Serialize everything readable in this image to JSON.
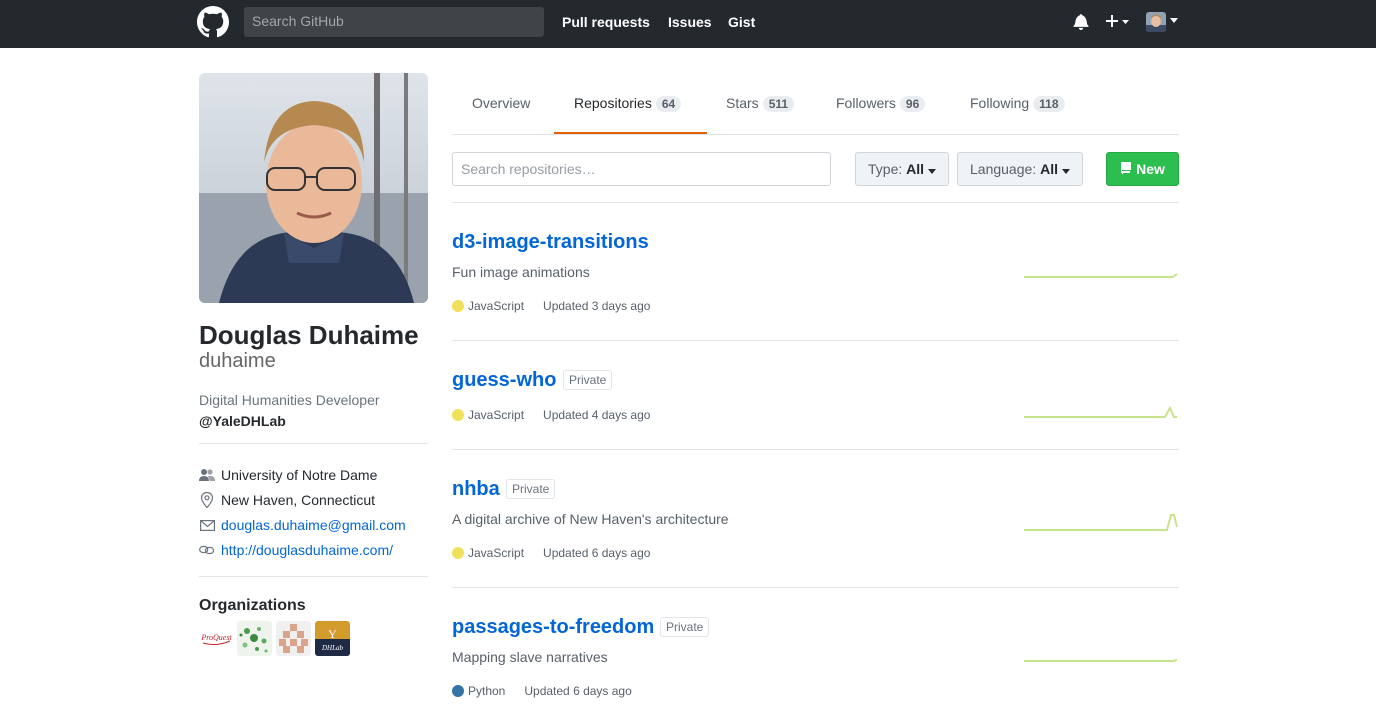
{
  "header": {
    "search_placeholder": "Search GitHub",
    "nav": [
      "Pull requests",
      "Issues",
      "Gist"
    ]
  },
  "profile": {
    "fullname": "Douglas Duhaime",
    "username": "duhaime",
    "bio": "Digital Humanities Developer",
    "handle": "@YaleDHLab",
    "organization": "University of Notre Dame",
    "location": "New Haven, Connecticut",
    "email": "douglas.duhaime@gmail.com",
    "website": "http://douglasduhaime.com/",
    "orgs_title": "Organizations"
  },
  "tabs": [
    {
      "label": "Overview",
      "count": ""
    },
    {
      "label": "Repositories",
      "count": "64"
    },
    {
      "label": "Stars",
      "count": "511"
    },
    {
      "label": "Followers",
      "count": "96"
    },
    {
      "label": "Following",
      "count": "118"
    }
  ],
  "filters": {
    "search_placeholder": "Search repositories…",
    "type_label": "Type:",
    "type_value": "All",
    "language_label": "Language:",
    "language_value": "All",
    "new_label": "New"
  },
  "repos": [
    {
      "name": "d3-image-transitions",
      "private": "",
      "desc": "Fun image animations",
      "lang": "JavaScript",
      "updated": "Updated 3 days ago"
    },
    {
      "name": "guess-who",
      "private": "Private",
      "desc": "",
      "lang": "JavaScript",
      "updated": "Updated 4 days ago"
    },
    {
      "name": "nhba",
      "private": "Private",
      "desc": "A digital archive of New Haven's architecture",
      "lang": "JavaScript",
      "updated": "Updated 6 days ago"
    },
    {
      "name": "passages-to-freedom",
      "private": "Private",
      "desc": "Mapping slave narratives",
      "lang": "Python",
      "updated": "Updated 6 days ago"
    }
  ],
  "org_logos": {
    "proquest": "ProQuest",
    "yale": "Y",
    "dhlab": "DHLab"
  },
  "colors": {
    "javascript": "#f1e05a",
    "python": "#3572A5",
    "accent_tab": "#e36209",
    "link": "#0366d6",
    "new_button": "#2cbe4e"
  }
}
